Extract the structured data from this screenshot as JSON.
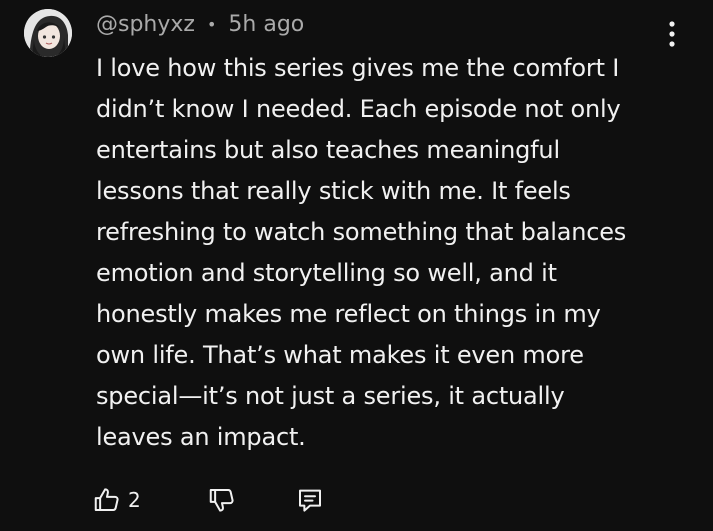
{
  "comment": {
    "author": "@sphyxz",
    "separator": "•",
    "time": "5h ago",
    "text": "I love how this series gives me the comfort I\ndidn’t know I needed. Each episode not only\nentertains but also teaches meaningful\nlessons that really stick with me. It feels\nrefreshing to watch something that balances\nemotion and storytelling so well, and it\nhonestly makes me reflect on things in my\nown life. That’s what makes it even more\nspecial—it’s not just a series, it actually\nleaves an impact.",
    "avatar_icon": "user-avatar-anime"
  },
  "actions": {
    "like_icon": "thumbs-up-icon",
    "like_count": "2",
    "dislike_icon": "thumbs-down-icon",
    "reply_icon": "comment-icon",
    "menu_icon": "more-vertical-icon"
  },
  "colors": {
    "background": "#0f0f0f",
    "text_primary": "#f1f1f1",
    "text_secondary": "#aaaaaa"
  }
}
